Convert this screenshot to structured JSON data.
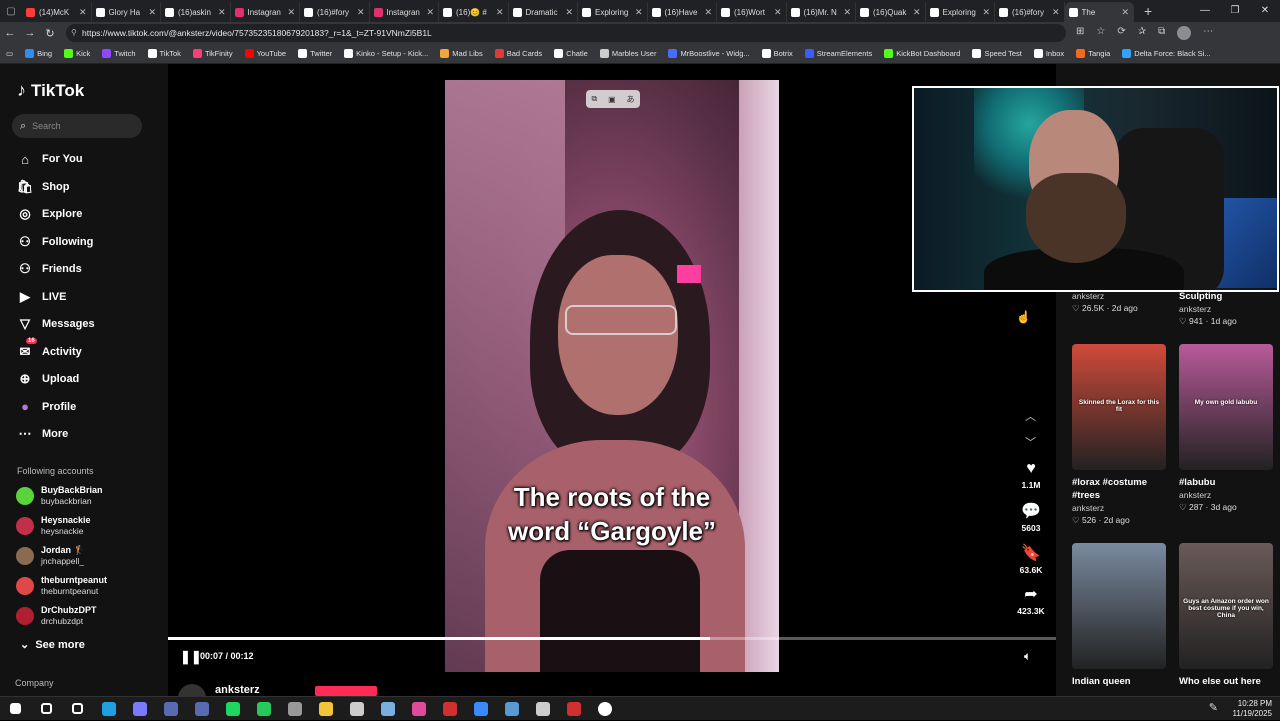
{
  "browser": {
    "tabs": [
      {
        "label": "(14)McK",
        "color": "#ff3b3b"
      },
      {
        "label": "Glory Ha",
        "color": "#ffffff"
      },
      {
        "label": "(16)askin",
        "color": "#ffffff"
      },
      {
        "label": "Instagran",
        "color": "#e1306c"
      },
      {
        "label": "(16)#fory",
        "color": "#ffffff"
      },
      {
        "label": "Instagran",
        "color": "#e1306c"
      },
      {
        "label": "(16)😊 #",
        "color": "#ffffff"
      },
      {
        "label": "Dramatic",
        "color": "#ffffff"
      },
      {
        "label": "Exploring",
        "color": "#ffffff"
      },
      {
        "label": "(16)Have",
        "color": "#ffffff"
      },
      {
        "label": "(16)Wort",
        "color": "#ffffff"
      },
      {
        "label": "(16)Mr. N",
        "color": "#ffffff"
      },
      {
        "label": "(16)Quak",
        "color": "#ffffff"
      },
      {
        "label": "Exploring",
        "color": "#ffffff"
      },
      {
        "label": "(16)#fory",
        "color": "#ffffff"
      },
      {
        "label": "The",
        "color": "#ffffff",
        "active": true
      }
    ],
    "url": "https://www.tiktok.com/@anksterz/video/7573523518067920183?_r=1&_t=ZT-91VNmZi5B1L",
    "bookmarks": [
      {
        "label": "Bing",
        "color": "#2f8cf0"
      },
      {
        "label": "Kick",
        "color": "#53fc18"
      },
      {
        "label": "Twitch",
        "color": "#9146ff"
      },
      {
        "label": "TikTok",
        "color": "#ffffff"
      },
      {
        "label": "TikFinity",
        "color": "#ff3b7a"
      },
      {
        "label": "YouTube",
        "color": "#ff0000"
      },
      {
        "label": "Twitter",
        "color": "#ffffff"
      },
      {
        "label": "Kinko - Setup - Kick...",
        "color": "#ffffff"
      },
      {
        "label": "Mad Libs",
        "color": "#f2a53a"
      },
      {
        "label": "Bad Cards",
        "color": "#e03a3a"
      },
      {
        "label": "Chatle",
        "color": "#ffffff"
      },
      {
        "label": "Marbles User",
        "color": "#cccccc"
      },
      {
        "label": "MrBoostlive - Widg...",
        "color": "#4a6bff"
      },
      {
        "label": "Botrix",
        "color": "#ffffff"
      },
      {
        "label": "StreamElements",
        "color": "#3b5bff"
      },
      {
        "label": "KickBot Dashboard",
        "color": "#53fc18"
      },
      {
        "label": "Speed Test",
        "color": "#ffffff"
      },
      {
        "label": "Inbox",
        "color": "#ffffff"
      },
      {
        "label": "Tangia",
        "color": "#f26b1d"
      },
      {
        "label": "Delta Force: Black Si...",
        "color": "#2fa3ff"
      }
    ]
  },
  "tiktok": {
    "logo": "TikTok",
    "search_placeholder": "Search",
    "nav": [
      {
        "label": "For You",
        "icon": "home-icon"
      },
      {
        "label": "Shop",
        "icon": "shop-icon"
      },
      {
        "label": "Explore",
        "icon": "compass-icon"
      },
      {
        "label": "Following",
        "icon": "following-icon"
      },
      {
        "label": "Friends",
        "icon": "friends-icon"
      },
      {
        "label": "LIVE",
        "icon": "live-icon"
      },
      {
        "label": "Messages",
        "icon": "messages-icon"
      },
      {
        "label": "Activity",
        "icon": "activity-icon",
        "badge": "16"
      },
      {
        "label": "Upload",
        "icon": "upload-icon"
      },
      {
        "label": "Profile",
        "icon": "profile-icon"
      },
      {
        "label": "More",
        "icon": "more-icon"
      }
    ],
    "following_title": "Following accounts",
    "following": [
      {
        "name": "BuyBackBrian",
        "handle": "buybackbrian",
        "color": "#5bd43a"
      },
      {
        "name": "Heysnackie",
        "handle": "heysnackie",
        "color": "#c0304a"
      },
      {
        "name": "Jordan 🏌",
        "handle": "jnchappell_",
        "color": "#8a6a50"
      },
      {
        "name": "theburntpeanut",
        "handle": "theburntpeanut",
        "color": "#e04848"
      },
      {
        "name": "DrChubzDPT",
        "handle": "drchubzdpt",
        "color": "#b02030"
      }
    ],
    "see_more": "See more",
    "company": "Company"
  },
  "video": {
    "caption_line1": "The roots of the",
    "caption_line2": "word “Gargoyle”",
    "time": "00:07 / 00:12",
    "progress_fraction": 0.61,
    "author": "anksterz",
    "actions": [
      {
        "name": "like",
        "icon": "heart-icon",
        "glyph": "♥",
        "count": "1.1M"
      },
      {
        "name": "comment",
        "icon": "comment-icon",
        "glyph": "💬",
        "count": "5603"
      },
      {
        "name": "bookmark",
        "icon": "bookmark-icon",
        "glyph": "🔖",
        "count": "63.6K"
      },
      {
        "name": "share",
        "icon": "share-icon",
        "glyph": "➦",
        "count": "423.3K"
      }
    ]
  },
  "related": {
    "top": [
      {
        "author": "anksterz",
        "meta": "♡ 26.5K · 2d ago"
      },
      {
        "title": "Sculpting",
        "author": "anksterz",
        "meta": "♡ 941 · 1d ago"
      }
    ],
    "cards": [
      {
        "thumb_text": "Skinned the Lorax for this fit",
        "title": "#lorax #costume #trees",
        "author": "anksterz",
        "meta": "♡ 526 · 2d ago",
        "bg": "#d04a3a"
      },
      {
        "thumb_text": "My own gold labubu",
        "title": "#labubu",
        "author": "anksterz",
        "meta": "♡ 287 · 3d ago",
        "bg": "#b85a9a"
      },
      {
        "thumb_text": "",
        "title": "Indian queen",
        "bg": "#7a8aa0"
      },
      {
        "thumb_text": "Guys an Amazon order won best costume if you win, China",
        "title": "Who else out here",
        "bg": "#6a5a58"
      }
    ]
  },
  "taskbar": {
    "time": "10:28 PM",
    "date": "11/19/2025",
    "icons": [
      {
        "name": "windows-start-icon",
        "color": "#ffffff"
      },
      {
        "name": "search-icon",
        "color": "#ffffff"
      },
      {
        "name": "task-view-icon",
        "color": "#ffffff"
      },
      {
        "name": "edge-icon",
        "color": "#1fa0e0"
      },
      {
        "name": "chrome-icon",
        "color": "#7a7aff"
      },
      {
        "name": "app-icon",
        "color": "#5a6ab0"
      },
      {
        "name": "app-icon",
        "color": "#5a6ab0"
      },
      {
        "name": "spotify-icon",
        "color": "#1ed760"
      },
      {
        "name": "app-icon",
        "color": "#27c95a"
      },
      {
        "name": "app-icon",
        "color": "#999999"
      },
      {
        "name": "file-explorer-icon",
        "color": "#f2c43a"
      },
      {
        "name": "app-icon",
        "color": "#cccccc"
      },
      {
        "name": "app-icon",
        "color": "#7ab0e0"
      },
      {
        "name": "app-icon",
        "color": "#e04a9a"
      },
      {
        "name": "app-icon",
        "color": "#d03030"
      },
      {
        "name": "app-icon",
        "color": "#3a8aff"
      },
      {
        "name": "app-icon",
        "color": "#5a9ad0"
      },
      {
        "name": "app-icon",
        "color": "#cccccc"
      },
      {
        "name": "app-icon",
        "color": "#d03030"
      },
      {
        "name": "settings-icon",
        "color": "#ffffff"
      }
    ]
  }
}
